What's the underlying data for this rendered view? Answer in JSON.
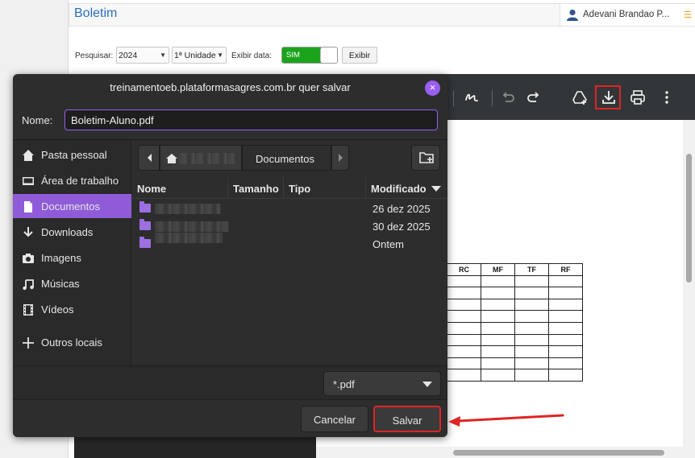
{
  "page": {
    "title": "Boletim",
    "user_name": "Adevani Brandao P...",
    "filters": {
      "search_label": "Pesquisar:",
      "year": "2024",
      "unit": "1ª Unidade",
      "show_date_label": "Exibir data:",
      "toggle_value": "SIM",
      "show_button": "Exibir"
    }
  },
  "viewer": {
    "toolbar_icons": [
      "draw-icon",
      "undo-icon",
      "redo-icon",
      "drive-add-icon",
      "download-icon",
      "print-icon",
      "more-vert-icon"
    ],
    "table_headers": [
      "RC",
      "MF",
      "TF",
      "RF"
    ],
    "table_body_rows": 9
  },
  "dialog": {
    "title": "treinamentoeb.plataformasagres.com.br quer salvar",
    "name_label": "Nome:",
    "file_name": "Boletim-Aluno.pdf",
    "places": [
      {
        "label": "Pasta pessoal",
        "icon": "home-icon",
        "active": false
      },
      {
        "label": "Área de trabalho",
        "icon": "desktop-icon",
        "active": false
      },
      {
        "label": "Documentos",
        "icon": "document-icon",
        "active": true
      },
      {
        "label": "Downloads",
        "icon": "download-icon",
        "active": false
      },
      {
        "label": "Imagens",
        "icon": "camera-icon",
        "active": false
      },
      {
        "label": "Músicas",
        "icon": "music-icon",
        "active": false
      },
      {
        "label": "Vídeos",
        "icon": "film-icon",
        "active": false
      },
      {
        "label": "Outros locais",
        "icon": "plus-icon",
        "active": false
      }
    ],
    "path_current": "Documentos",
    "columns": [
      "Nome",
      "Tamanho",
      "Tipo",
      "Modificado"
    ],
    "files": [
      {
        "modified": "26 dez 2025"
      },
      {
        "modified": "30 dez 2025"
      },
      {
        "modified": "Ontem"
      }
    ],
    "file_filter": "*.pdf",
    "cancel_label": "Cancelar",
    "save_label": "Salvar"
  },
  "colors": {
    "accent": "#8f5bd8",
    "highlight": "#e02424",
    "toggle_on": "#1ca31c",
    "title_link": "#2a6ebd"
  }
}
